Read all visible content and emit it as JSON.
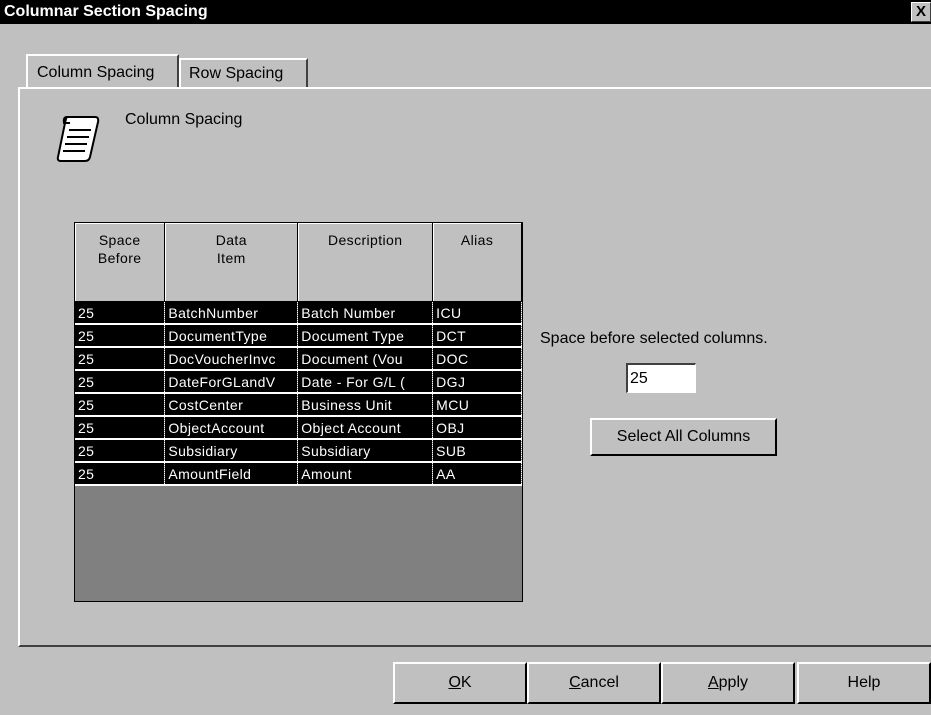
{
  "window": {
    "title": "Columnar Section Spacing",
    "close_label": "X"
  },
  "tabs": [
    {
      "label": "Column Spacing",
      "active": true
    },
    {
      "label": "Row Spacing",
      "active": false
    }
  ],
  "section": {
    "heading": "Column Spacing",
    "icon": "scroll-document-icon"
  },
  "grid": {
    "columns": [
      {
        "line1": "Space",
        "line2": "Before"
      },
      {
        "line1": "Data",
        "line2": "Item"
      },
      {
        "line1": "Description",
        "line2": ""
      },
      {
        "line1": "Alias",
        "line2": ""
      }
    ],
    "rows": [
      [
        "25",
        "BatchNumber",
        "Batch Number",
        "ICU"
      ],
      [
        "25",
        "DocumentType",
        "Document Type",
        "DCT"
      ],
      [
        "25",
        "DocVoucherInvc",
        "Document (Vou",
        "DOC"
      ],
      [
        "25",
        "DateForGLandV",
        "Date - For G/L (",
        "DGJ"
      ],
      [
        "25",
        "CostCenter",
        "Business Unit",
        "MCU"
      ],
      [
        "25",
        "ObjectAccount",
        "Object Account",
        "OBJ"
      ],
      [
        "25",
        "Subsidiary",
        "Subsidiary",
        "SUB"
      ],
      [
        "25",
        "AmountField",
        "Amount",
        "AA"
      ]
    ]
  },
  "spacing": {
    "label": "Space before selected columns.",
    "value": "25",
    "select_all_label": "Select All Columns"
  },
  "buttons": {
    "ok": {
      "mnemonic": "O",
      "rest": "K"
    },
    "cancel": {
      "mnemonic": "C",
      "rest": "ancel"
    },
    "apply": {
      "mnemonic": "A",
      "rest": "pply"
    },
    "help": "Help"
  }
}
